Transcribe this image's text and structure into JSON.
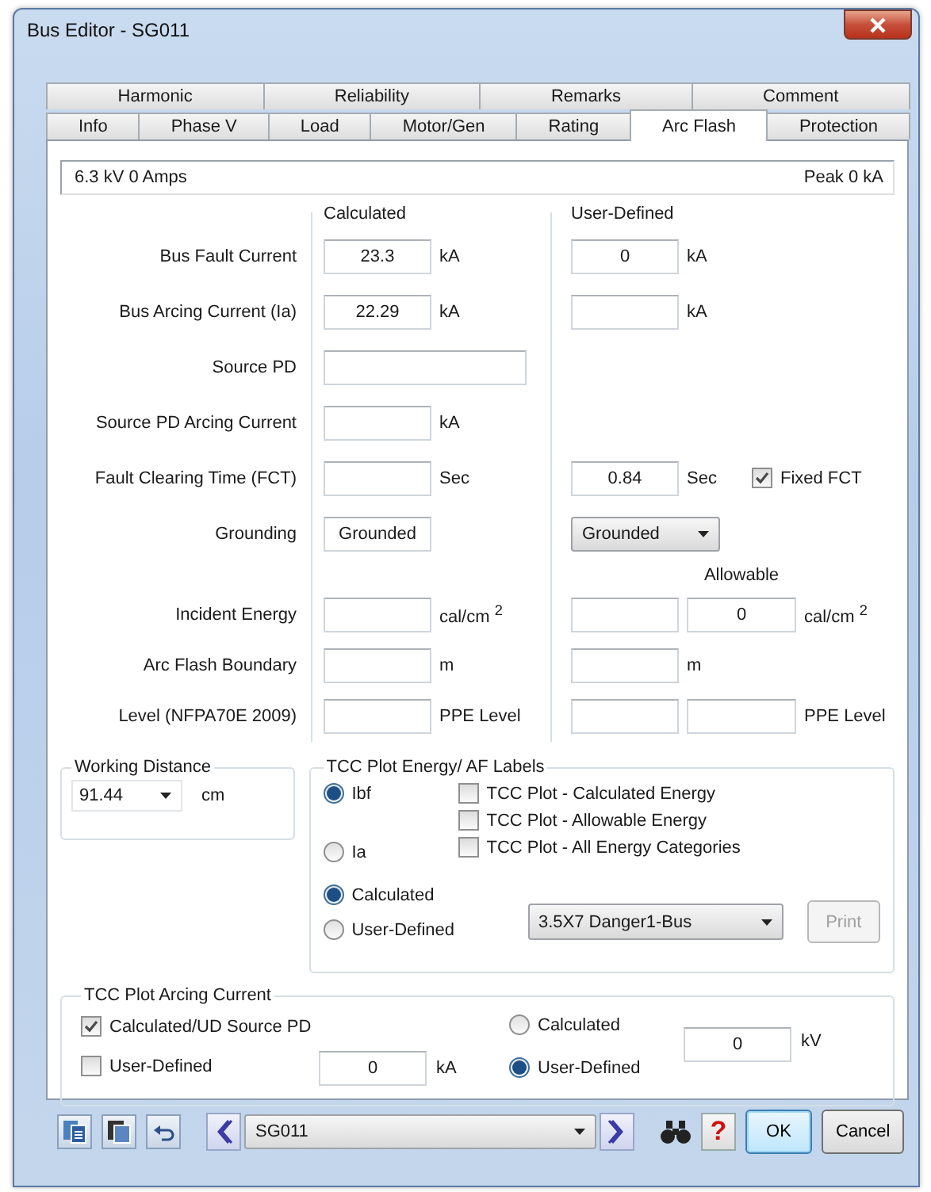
{
  "window": {
    "title": "Bus Editor - SG011"
  },
  "tab_rows": [
    {
      "tabs": [
        {
          "label": "Harmonic",
          "selected": false
        },
        {
          "label": "Reliability",
          "selected": false
        },
        {
          "label": "Remarks",
          "selected": false
        },
        {
          "label": "Comment",
          "selected": false
        }
      ]
    },
    {
      "tabs": [
        {
          "label": "Info",
          "selected": false
        },
        {
          "label": "Phase V",
          "selected": false
        },
        {
          "label": "Load",
          "selected": false
        },
        {
          "label": "Motor/Gen",
          "selected": false
        },
        {
          "label": "Rating",
          "selected": false
        },
        {
          "label": "Arc Flash",
          "selected": true
        },
        {
          "label": "Protection",
          "selected": false
        }
      ]
    }
  ],
  "status": {
    "rating": "6.3 kV 0 Amps",
    "peak": "Peak 0 kA"
  },
  "columns": {
    "calculated": "Calculated",
    "user_defined": "User-Defined"
  },
  "rows": [
    {
      "kind": "field",
      "label": "Bus Fault Current",
      "calc": {
        "kind": "input",
        "value": "23.3",
        "unit": "kA"
      },
      "user": {
        "kind": "input",
        "value": "0",
        "unit": "kA"
      }
    },
    {
      "kind": "field",
      "label": "Bus Arcing Current (Ia)",
      "calc": {
        "kind": "input",
        "value": "22.29",
        "unit": "kA"
      },
      "user": {
        "kind": "input",
        "unit": "kA"
      }
    },
    {
      "kind": "field",
      "label": "Source PD",
      "calc": {
        "kind": "wide"
      }
    },
    {
      "kind": "field",
      "label": "Source PD Arcing Current",
      "calc": {
        "kind": "input",
        "unit": "kA"
      }
    },
    {
      "kind": "field",
      "label": "Fault Clearing Time (FCT)",
      "calc": {
        "kind": "input",
        "unit": "Sec"
      },
      "user": {
        "kind": "input",
        "value": "0.84",
        "unit": "Sec"
      },
      "option": {
        "label": "Fixed FCT",
        "checked": true
      }
    },
    {
      "kind": "field",
      "label": "Grounding",
      "calc": {
        "kind": "input",
        "value": "Grounded"
      },
      "user": {
        "kind": "select",
        "value": "Grounded"
      }
    },
    {
      "kind": "subheader",
      "label": "Allowable"
    },
    {
      "kind": "field",
      "label": "Incident Energy",
      "calc": {
        "kind": "input",
        "unit": "cal/cm $^{2}$"
      },
      "user": {
        "kind": "input"
      },
      "allowable": {
        "kind": "input",
        "value": "0",
        "unit": "cal/cm $^{2}$"
      }
    },
    {
      "kind": "field",
      "label": "Arc Flash Boundary",
      "calc": {
        "kind": "input",
        "unit": "m"
      },
      "user": {
        "kind": "input",
        "unit": "m"
      }
    },
    {
      "kind": "field",
      "label": "Level (NFPA70E 2009)",
      "calc": {
        "kind": "input",
        "unit": "PPE Level"
      },
      "user": {
        "kind": "input"
      },
      "allowable": {
        "kind": "input",
        "unit": "PPE Level"
      }
    }
  ],
  "working_distance": {
    "title": "Working Distance",
    "value": "91.44",
    "unit": "cm"
  },
  "energy_labels": {
    "title": "TCC Plot Energy/ AF Labels",
    "current": [
      {
        "label": "Ibf",
        "selected": true
      },
      {
        "label": "Ia",
        "selected": false
      }
    ],
    "plots": [
      {
        "label": "TCC Plot - Calculated Energy",
        "checked": false
      },
      {
        "label": "TCC Plot - Allowable Energy",
        "checked": false
      },
      {
        "label": "TCC Plot - All Energy Categories",
        "checked": false
      }
    ],
    "source": [
      {
        "label": "Calculated",
        "selected": true
      },
      {
        "label": "User-Defined",
        "selected": false
      }
    ],
    "label_template": "3.5X7 Danger1-Bus",
    "print": {
      "label": "Print",
      "disabled": true
    }
  },
  "arcing_current": {
    "title": "TCC Plot Arcing Current",
    "options": [
      {
        "label": "Calculated/UD Source PD",
        "checked": true
      },
      {
        "label": "User-Defined",
        "checked": false
      }
    ],
    "current": {
      "value": "0",
      "unit": "kA"
    },
    "voltage_source": [
      {
        "label": "Calculated",
        "selected": false
      },
      {
        "label": "User-Defined",
        "selected": true
      }
    ],
    "voltage": {
      "value": "0",
      "unit": "kV"
    }
  },
  "toolbar": {
    "bus": "SG011",
    "help": "?",
    "buttons": [
      {
        "label": "OK",
        "default": true
      },
      {
        "label": "Cancel",
        "default": false
      }
    ]
  }
}
